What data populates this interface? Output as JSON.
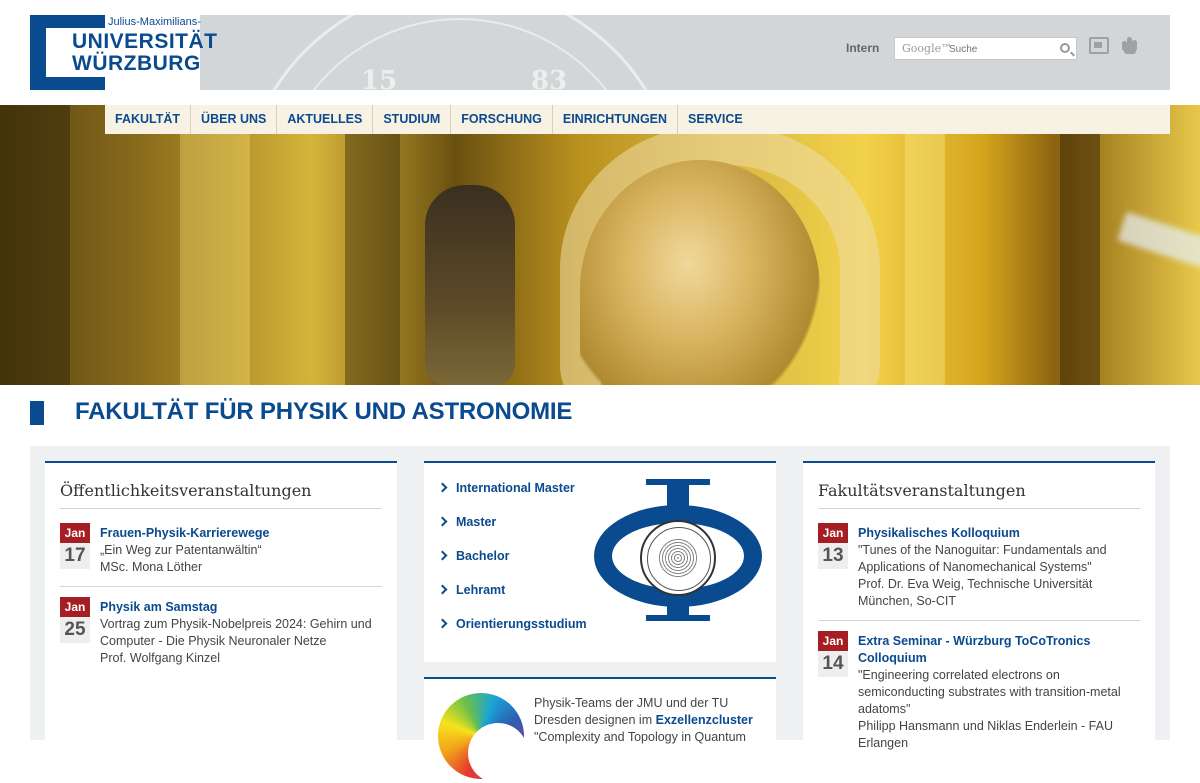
{
  "header": {
    "logo_line1": "Julius-Maximilians-",
    "logo_line2": "UNIVERSITÄT",
    "logo_line3": "WÜRZBURG",
    "seal_left_number": "15",
    "seal_right_number": "83",
    "intern_label": "Intern",
    "search_brand": "Google™",
    "search_placeholder": "Suche"
  },
  "nav": {
    "items": [
      "FAKULTÄT",
      "ÜBER UNS",
      "AKTUELLES",
      "STUDIUM",
      "FORSCHUNG",
      "EINRICHTUNGEN",
      "SERVICE"
    ]
  },
  "page_title": "FAKULTÄT FÜR PHYSIK UND ASTRONOMIE",
  "public_events": {
    "heading": "Öffentlichkeitsveranstaltungen",
    "items": [
      {
        "month": "Jan",
        "day": "17",
        "title": "Frauen-Physik-Karrierewege",
        "line1": "„Ein Weg zur Patentanwältin“",
        "line2": "MSc. Mona Löther"
      },
      {
        "month": "Jan",
        "day": "25",
        "title": "Physik am Samstag",
        "line1": "Vortrag zum Physik-Nobelpreis 2024: Gehirn und",
        "line2": "Computer - Die Physik Neuronaler Netze",
        "line3": "Prof. Wolfgang Kinzel"
      }
    ]
  },
  "study_links": {
    "items": [
      "International Master",
      "Master",
      "Bachelor",
      "Lehramt",
      "Orientierungsstudium"
    ]
  },
  "promo": {
    "line1": "Physik-Teams der JMU und der TU",
    "line2_prefix": "Dresden designen im ",
    "line2_link": "Exzellenzcluster",
    "line3": "\"Complexity and Topology in Quantum"
  },
  "faculty_events": {
    "heading": "Fakultätsveranstaltungen",
    "items": [
      {
        "month": "Jan",
        "day": "13",
        "title": "Physikalisches Kolloquium",
        "line1": "\"Tunes of the Nanoguitar: Fundamentals and",
        "line2": "Applications of Nanomechanical Systems\"",
        "line3": "Prof. Dr. Eva Weig, Technische Universität",
        "line4": "München, So-CIT"
      },
      {
        "month": "Jan",
        "day": "14",
        "title_line1": "Extra Seminar - Würzburg ToCoTronics",
        "title_line2": "Colloquium",
        "line1": "\"Engineering correlated electrons on",
        "line2": "semiconducting substrates with transition-metal",
        "line3": "adatoms\"",
        "line4": "Philipp Hansmann und Niklas Enderlein - FAU",
        "line5": "Erlangen"
      }
    ]
  },
  "colors": {
    "brand_blue": "#0a4a8f",
    "date_red": "#a51e23",
    "header_gray": "#d3d6d8",
    "nav_bg": "#f7f2e4"
  }
}
